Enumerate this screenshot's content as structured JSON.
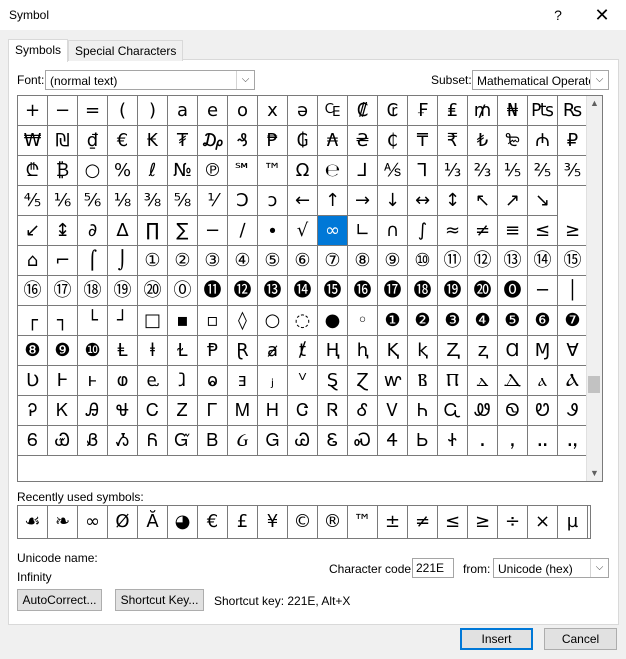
{
  "window": {
    "title": "Symbol",
    "help_label": "?",
    "close_label": "✕"
  },
  "tabs": [
    {
      "label": "Symbols",
      "active": true
    },
    {
      "label": "Special Characters",
      "active": false
    }
  ],
  "font": {
    "label": "Font:",
    "value": "(normal text)"
  },
  "subset": {
    "label": "Subset:",
    "value": "Mathematical Operato"
  },
  "symbol_grid": {
    "selected": "∞",
    "rows": [
      [
        "+",
        "−",
        "=",
        "(",
        ")",
        "a",
        "e",
        "o",
        "x",
        "ə",
        "₠",
        "₡",
        "₢",
        "₣",
        "₤",
        "₥",
        "₦",
        "₧",
        "₨"
      ],
      [
        "₩",
        "₪",
        "₫",
        "€",
        "₭",
        "₮",
        "₯",
        "₰",
        "₱",
        "₲",
        "₳",
        "₴",
        "₵",
        "₸",
        "₹",
        "₺",
        "₻",
        "₼",
        "₽"
      ],
      [
        "₾",
        "₿",
        "○",
        "%",
        "ℓ",
        "№",
        "℗",
        "℠",
        "™",
        "Ω",
        "℮",
        "⅃",
        "⅍",
        "⅂",
        "⅓",
        "⅔",
        "⅕",
        "⅖",
        "⅗"
      ],
      [
        "⅘",
        "⅙",
        "⅚",
        "⅛",
        "⅜",
        "⅝",
        "⅟",
        "Ↄ",
        "ↄ",
        "←",
        "↑",
        "→",
        "↓",
        "↔",
        "↕",
        "↖",
        "↗",
        "↘"
      ],
      [
        "↙",
        "↨",
        "∂",
        "∆",
        "∏",
        "∑",
        "−",
        "∕",
        "∙",
        "√",
        "∞",
        "∟",
        "∩",
        "∫",
        "≈",
        "≠",
        "≡",
        "≤",
        "≥"
      ],
      [
        "⌂",
        "⌐",
        "⌠",
        "⌡",
        "①",
        "②",
        "③",
        "④",
        "⑤",
        "⑥",
        "⑦",
        "⑧",
        "⑨",
        "⑩",
        "⑪",
        "⑫",
        "⑬",
        "⑭",
        "⑮"
      ],
      [
        "⑯",
        "⑰",
        "⑱",
        "⑲",
        "⑳",
        "⓪",
        "⓫",
        "⓬",
        "⓭",
        "⓮",
        "⓯",
        "⓰",
        "⓱",
        "⓲",
        "⓳",
        "⓴",
        "⓿",
        "─",
        "│"
      ],
      [
        "┌",
        "┐",
        "└",
        "┘",
        "□",
        "▪",
        "▫",
        "◊",
        "○",
        "◌",
        "●",
        "◦",
        "❶",
        "❷",
        "❸",
        "❹",
        "❺",
        "❻",
        "❼"
      ],
      [
        "❽",
        "❾",
        "❿",
        "Ⱡ",
        "ⱡ",
        "Ɫ",
        "Ᵽ",
        "Ɽ",
        "ⱥ",
        "ⱦ",
        "Ⱨ",
        "ⱨ",
        "Ⱪ",
        "ⱪ",
        "Ⱬ",
        "ⱬ",
        "Ɑ",
        "Ɱ",
        "Ɐ"
      ],
      [
        "Ʋ",
        "Ⱶ",
        "ⱶ",
        "ⱷ",
        "ⱸ",
        "ⱹ",
        "ⱺ",
        "ⱻ",
        "ⱼ",
        "ⱽ",
        "Ȿ",
        "Ɀ",
        "ⱳ",
        "Ⲃ",
        "Ⲡ",
        "ⲇ",
        "Ⲇ",
        "ⲁ",
        "Ⲁ"
      ],
      [
        "Ꭾ",
        "Ꮶ",
        "Ꭿ",
        "Ꮰ",
        "Ꮯ",
        "Ꮓ",
        "Ꮁ",
        "Ꮇ",
        "Ꮋ",
        "Ꮳ",
        "Ꮢ",
        "Ꮄ",
        "Ꮩ",
        "Ꮒ",
        "Ꮹ",
        "Ꮺ",
        "Ꮻ",
        "Ꮼ",
        "Ꮽ"
      ],
      [
        "Ꮾ",
        "Ꮿ",
        "Ᏸ",
        "Ᏹ",
        "Ᏺ",
        "Ᏻ",
        "Ᏼ",
        "Ᏽ",
        "Ꮐ",
        "Ꮚ",
        "Ꮛ",
        "Ꮝ",
        "Ꮞ",
        "Ꮟ",
        "Ꮠ",
        "ꓸ",
        "ꓹ",
        "ꓺ",
        "ꓻ"
      ]
    ]
  },
  "recent": {
    "label": "Recently used symbols:",
    "symbols": [
      "☙",
      "❧",
      "∞",
      "Ø",
      "Ă",
      "◕",
      "€",
      "£",
      "¥",
      "©",
      "®",
      "™",
      "±",
      "≠",
      "≤",
      "≥",
      "÷",
      "×",
      "µ"
    ]
  },
  "unicode_name": {
    "label": "Unicode name:",
    "value": "Infinity"
  },
  "character_code": {
    "label": "Character code:",
    "value": "221E"
  },
  "from": {
    "label": "from:",
    "value": "Unicode (hex)"
  },
  "buttons": {
    "autocorrect": "AutoCorrect...",
    "shortcut_key": "Shortcut Key...",
    "insert": "Insert",
    "cancel": "Cancel"
  },
  "shortcut_text": "Shortcut key: 221E, Alt+X"
}
